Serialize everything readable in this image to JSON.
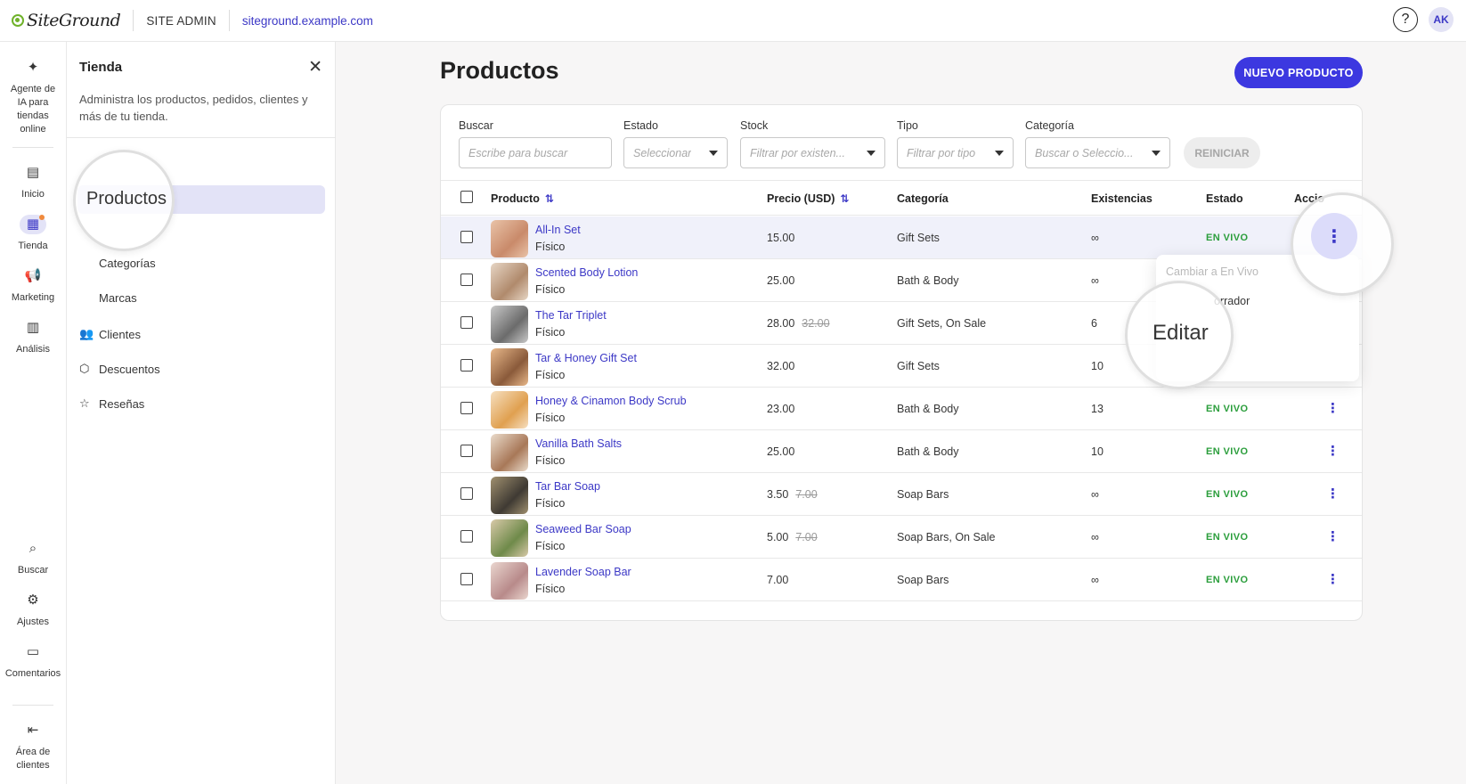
{
  "topbar": {
    "logo_text": "SiteGround",
    "section": "SITE ADMIN",
    "site_url": "siteground.example.com",
    "help_icon": "question-circle-icon",
    "avatar_initials": "AK"
  },
  "rail": {
    "items": [
      {
        "label": "Agente de IA para tiendas online",
        "icon": "sparkle-icon"
      },
      {
        "label": "Inicio",
        "icon": "dashboard-icon"
      },
      {
        "label": "Tienda",
        "icon": "store-icon",
        "active": true
      },
      {
        "label": "Marketing",
        "icon": "megaphone-icon"
      },
      {
        "label": "Análisis",
        "icon": "chart-icon"
      },
      {
        "label": "Buscar",
        "icon": "search-icon"
      },
      {
        "label": "Ajustes",
        "icon": "gear-icon"
      },
      {
        "label": "Comentarios",
        "icon": "comment-icon"
      },
      {
        "label": "Área de clientes",
        "icon": "exit-icon"
      }
    ]
  },
  "panel": {
    "title": "Tienda",
    "description": "Administra los productos, pedidos, clientes y más de tu tienda.",
    "nav": {
      "productos": "Productos",
      "categorias": "Categorías",
      "marcas": "Marcas",
      "clientes": "Clientes",
      "descuentos": "Descuentos",
      "resenas": "Reseñas"
    }
  },
  "main": {
    "title": "Productos",
    "new_button": "NUEVO PRODUCTO",
    "filters": {
      "buscar_label": "Buscar",
      "buscar_placeholder": "Escribe para buscar",
      "estado_label": "Estado",
      "estado_placeholder": "Seleccionar",
      "stock_label": "Stock",
      "stock_placeholder": "Filtrar por existen...",
      "tipo_label": "Tipo",
      "tipo_placeholder": "Filtrar por tipo",
      "categoria_label": "Categoría",
      "categoria_placeholder": "Buscar o Seleccio...",
      "reset": "REINICIAR"
    },
    "columns": {
      "producto": "Producto",
      "precio": "Precio (USD)",
      "categoria": "Categoría",
      "existencias": "Existencias",
      "estado": "Estado",
      "acciones": "Accio"
    },
    "rows": [
      {
        "name": "All-In Set",
        "type": "Físico",
        "price": "15.00",
        "old_price": "",
        "category": "Gift Sets",
        "stock": "∞",
        "status": "EN VIVO"
      },
      {
        "name": "Scented Body Lotion",
        "type": "Físico",
        "price": "25.00",
        "old_price": "",
        "category": "Bath & Body",
        "stock": "∞",
        "status": ""
      },
      {
        "name": "The Tar Triplet",
        "type": "Físico",
        "price": "28.00",
        "old_price": "32.00",
        "category": "Gift Sets, On Sale",
        "stock": "6",
        "status": ""
      },
      {
        "name": "Tar & Honey Gift Set",
        "type": "Físico",
        "price": "32.00",
        "old_price": "",
        "category": "Gift Sets",
        "stock": "10",
        "status": ""
      },
      {
        "name": "Honey & Cinamon Body Scrub",
        "type": "Físico",
        "price": "23.00",
        "old_price": "",
        "category": "Bath & Body",
        "stock": "13",
        "status": "EN VIVO"
      },
      {
        "name": "Vanilla Bath Salts",
        "type": "Físico",
        "price": "25.00",
        "old_price": "",
        "category": "Bath & Body",
        "stock": "10",
        "status": "EN VIVO"
      },
      {
        "name": "Tar Bar Soap",
        "type": "Físico",
        "price": "3.50",
        "old_price": "7.00",
        "category": "Soap Bars",
        "stock": "∞",
        "status": "EN VIVO"
      },
      {
        "name": "Seaweed Bar Soap",
        "type": "Físico",
        "price": "5.00",
        "old_price": "7.00",
        "category": "Soap Bars, On Sale",
        "stock": "∞",
        "status": "EN VIVO"
      },
      {
        "name": "Lavender Soap Bar",
        "type": "Físico",
        "price": "7.00",
        "old_price": "",
        "category": "Soap Bars",
        "stock": "∞",
        "status": "EN VIVO"
      }
    ],
    "menu": {
      "set_live": "Cambiar a En Vivo",
      "draft": "orrador",
      "edit": "Editar"
    }
  },
  "colors": {
    "accent": "#3c38e0",
    "link": "#3c38c6",
    "live": "#2b9e3c",
    "brand_green": "#6fb22a"
  }
}
